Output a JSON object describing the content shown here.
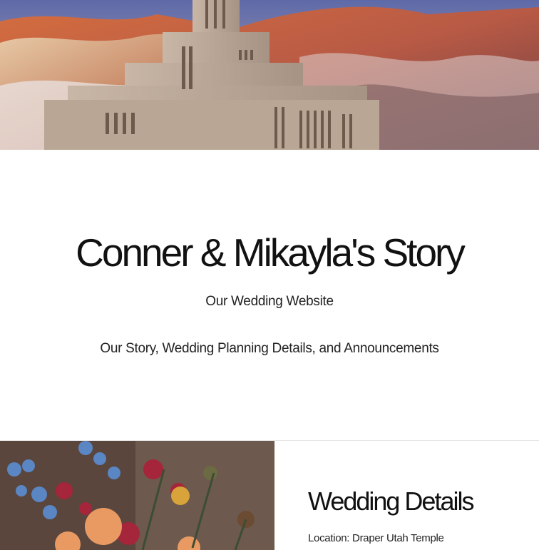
{
  "hero": {
    "image": "temple-mountains-photo"
  },
  "main": {
    "title": "Conner & Mikayla's Story",
    "subtitle": "Our Wedding Website",
    "tagline": "Our Story, Wedding Planning Details, and Announcements"
  },
  "details": {
    "image": "floral-bouquet-photo",
    "heading": "Wedding Details",
    "location": "Location: Draper Utah Temple"
  },
  "colors": {
    "background": "#ffffff",
    "text": "#111111",
    "divider": "#e6e6e6"
  }
}
